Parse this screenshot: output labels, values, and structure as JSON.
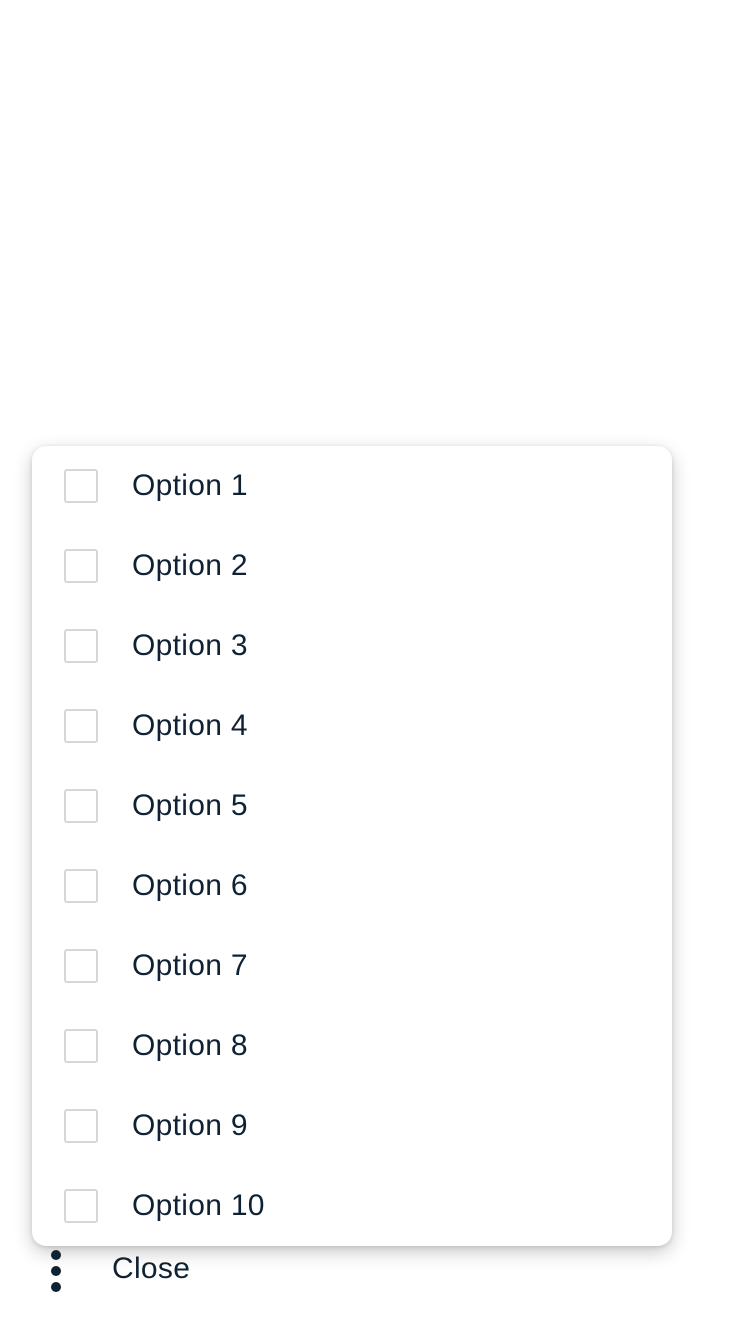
{
  "menu": {
    "items": [
      {
        "label": "Option 1",
        "checked": false
      },
      {
        "label": "Option 2",
        "checked": false
      },
      {
        "label": "Option 3",
        "checked": false
      },
      {
        "label": "Option 4",
        "checked": false
      },
      {
        "label": "Option 5",
        "checked": false
      },
      {
        "label": "Option 6",
        "checked": false
      },
      {
        "label": "Option 7",
        "checked": false
      },
      {
        "label": "Option 8",
        "checked": false
      },
      {
        "label": "Option 9",
        "checked": false
      },
      {
        "label": "Option 10",
        "checked": false
      }
    ]
  },
  "footer": {
    "more_icon": "more-vertical-icon",
    "close_label": "Close"
  },
  "colors": {
    "text": "#0f2233",
    "checkbox_border": "#d4d6d9",
    "background": "#ffffff"
  }
}
